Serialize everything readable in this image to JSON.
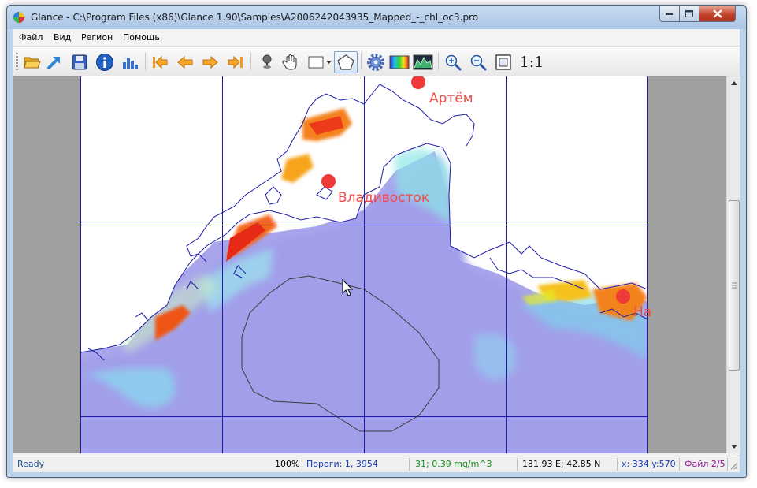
{
  "window": {
    "title": "Glance - C:\\Program Files (x86)\\Glance 1.90\\Samples\\A2006242043935_Mapped_-_chl_oc3.pro"
  },
  "menu": [
    "Файл",
    "Вид",
    "Регион",
    "Помощь"
  ],
  "toolbar": {
    "icons": [
      "open-folder-icon",
      "export-arrow-icon",
      "save-icon",
      "info-icon",
      "histogram-icon",
      "first-file-icon",
      "previous-file-icon",
      "next-file-icon",
      "last-file-icon",
      "pin-icon",
      "hand-pan-icon",
      "rectangle-select-icon",
      "polygon-select-icon",
      "settings-gear-icon",
      "palette-icon",
      "spectrum-icon",
      "zoom-in-icon",
      "zoom-out-icon",
      "zoom-fit-icon"
    ],
    "zoom_actual_label": "1:1"
  },
  "map": {
    "cities": [
      {
        "name": "Артём"
      },
      {
        "name": "Владивосток"
      },
      {
        "name": "На"
      }
    ],
    "colors": {
      "grid": "#1c1ca8",
      "coast": "#1c1ca8",
      "marker": "#f03a3a",
      "label": "#ef4a4a"
    }
  },
  "status": {
    "ready": "Ready",
    "zoom": "100%",
    "thresholds": "Пороги: 1, 3954",
    "pixel_value": "31; 0.39 mg/m^3",
    "geo": "131.93 E; 42.85 N",
    "xy": "x: 334 y:570",
    "file": "Файл 2/5"
  }
}
